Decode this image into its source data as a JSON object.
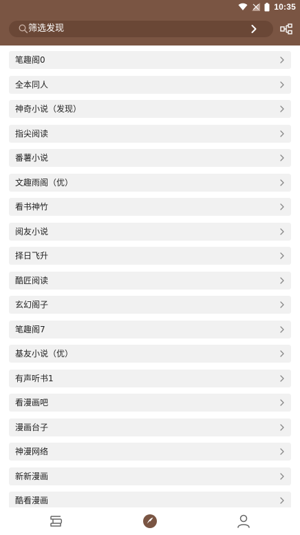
{
  "status_bar": {
    "time": "10:35"
  },
  "search": {
    "placeholder": "筛选发现"
  },
  "sources": [
    {
      "label": "笔趣阁0"
    },
    {
      "label": "全本同人"
    },
    {
      "label": "神奇小说（发现）"
    },
    {
      "label": "指尖阅读"
    },
    {
      "label": "番薯小说"
    },
    {
      "label": "文趣雨阁（优）"
    },
    {
      "label": "看书神竹"
    },
    {
      "label": "阅友小说"
    },
    {
      "label": "择日飞升"
    },
    {
      "label": "酷匠阅读"
    },
    {
      "label": "玄幻阁子"
    },
    {
      "label": "笔趣阁7"
    },
    {
      "label": "基友小说（优）"
    },
    {
      "label": "有声听书1"
    },
    {
      "label": "看漫画吧"
    },
    {
      "label": "漫画台子"
    },
    {
      "label": "神漫网络"
    },
    {
      "label": "新新漫画"
    },
    {
      "label": "酷看漫画"
    }
  ],
  "icons": {
    "search": "search-icon",
    "go": "chevron-right-icon",
    "share": "share-nodes-icon",
    "item_arrow": "chevron-right-icon",
    "nav_bookshelf": "bookshelf-icon",
    "nav_explore": "compass-icon",
    "nav_profile": "person-icon"
  },
  "colors": {
    "header": "#7a5543",
    "search_bg": "#6a4736",
    "item_bg": "#f1f1f1",
    "nav_active": "#7a5543",
    "nav_inactive": "#666666"
  }
}
